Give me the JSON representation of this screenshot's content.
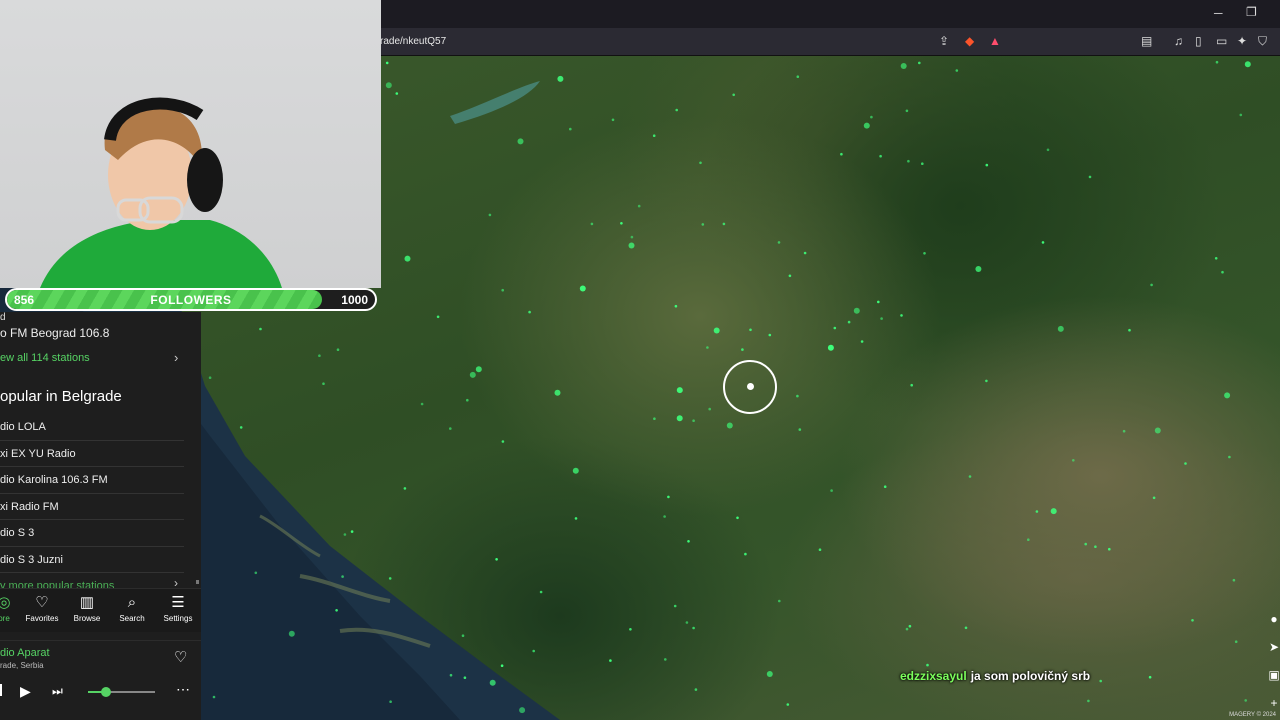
{
  "browser": {
    "url_fragment": "rade/nkeutQ57",
    "window_controls": {
      "minimize": "─",
      "restore": "❐"
    },
    "toolbar_icons": [
      "share-icon",
      "brave-shields-icon",
      "brave-rewards-icon",
      "sidebar-icon",
      "music-icon",
      "reader-icon",
      "wallet-icon",
      "extensions-icon",
      "vpn-icon"
    ],
    "rewards_badge": "1"
  },
  "follower_goal": {
    "current": "856",
    "label": "FOLLOWERS",
    "goal": "1000",
    "progress_fraction": 0.856
  },
  "radio_panel": {
    "stub_label": "d",
    "current_station": "o FM Beograd 106.8",
    "view_all": "ew all 114 stations",
    "popular_heading": "opular in Belgrade",
    "popular_stations": [
      "dio LOLA",
      "xi EX YU Radio",
      "dio Karolina 106.3 FM",
      "xi Radio FM",
      "dio S 3",
      "dio S 3 Juzni"
    ],
    "more_popular": "y more popular stations",
    "tabs": [
      {
        "label": "ore",
        "icon": "compass-icon"
      },
      {
        "label": "Favorites",
        "icon": "heart-icon"
      },
      {
        "label": "Browse",
        "icon": "map-icon"
      },
      {
        "label": "Search",
        "icon": "search-icon"
      },
      {
        "label": "Settings",
        "icon": "menu-icon"
      }
    ],
    "player": {
      "station": "dio Aparat",
      "location": "rade, Serbia",
      "volume_fraction": 0.27
    }
  },
  "map": {
    "attribution": "MAGERY © 2024",
    "controls": [
      "globe-icon",
      "locate-icon",
      "lock-icon",
      "zoom-in-icon",
      "zoom-out-icon"
    ]
  },
  "chat": {
    "username": "edzzixsayul",
    "message": "ja som polovičný srb"
  },
  "colors": {
    "accent": "#56d364",
    "chat_user": "#7cff5c",
    "follow_fill": "#5cd65c",
    "map_dot": "#3dff7a"
  }
}
